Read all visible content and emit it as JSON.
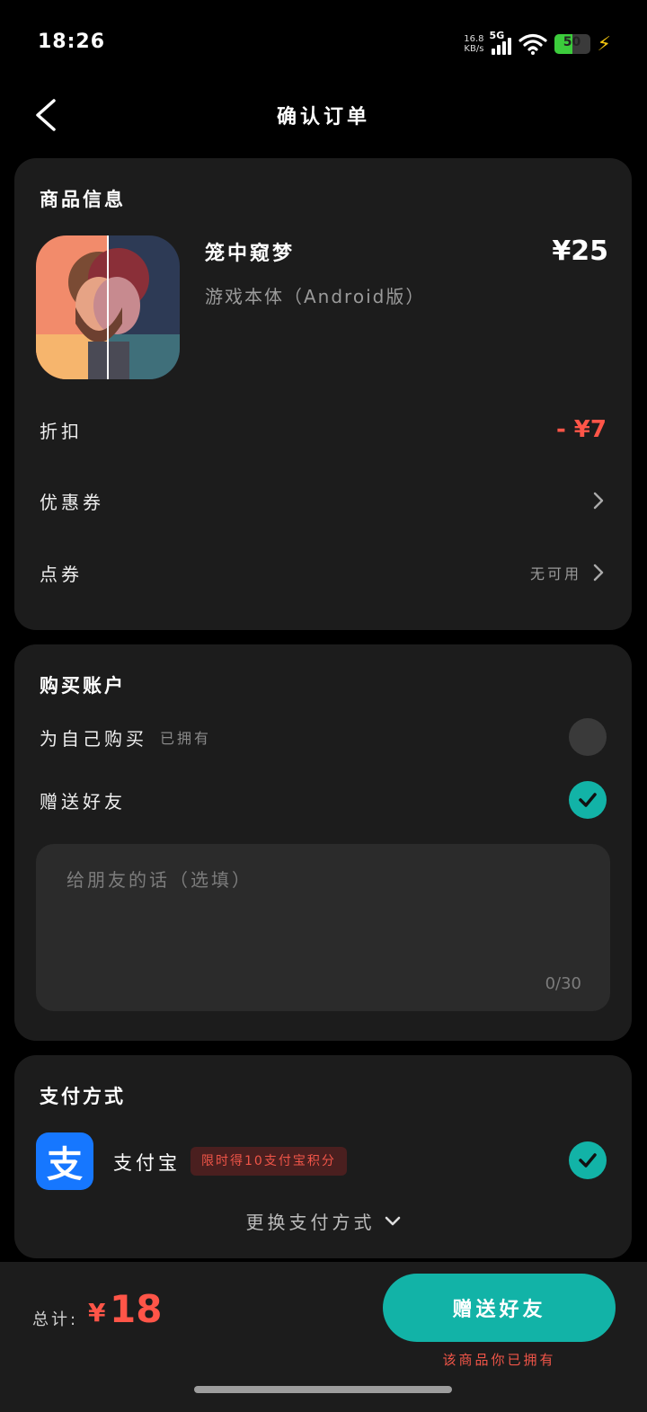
{
  "status_bar": {
    "time": "18:26",
    "net_speed_value": "16.8",
    "net_speed_unit": "KB/s",
    "network_type": "5G",
    "battery_level": "50"
  },
  "nav": {
    "title": "确认订单"
  },
  "product_section": {
    "title": "商品信息",
    "product_name": "笼中窥梦",
    "edition": "游戏本体（Android版）",
    "price": "¥25",
    "discount_label": "折扣",
    "discount_value": "- ¥7",
    "coupon_label": "优惠券",
    "points_label": "点券",
    "points_value": "无可用"
  },
  "account_section": {
    "title": "购买账户",
    "self_purchase_label": "为自己购买",
    "self_owned_tag": "已拥有",
    "gift_label": "赠送好友",
    "message_placeholder": "给朋友的话（选填）",
    "message_count": "0/30",
    "selected_option": "gift"
  },
  "payment_section": {
    "title": "支付方式",
    "method_icon_char": "支",
    "method_name": "支付宝",
    "promo": "限时得10支付宝积分",
    "change_label": "更换支付方式"
  },
  "bottom_bar": {
    "total_label": "总计:",
    "currency": "¥",
    "total_value": "18",
    "action_label": "赠送好友",
    "owned_notice": "该商品你已拥有"
  },
  "colors": {
    "accent": "#12b3a7",
    "price_red": "#ff5548",
    "card_bg": "#1c1c1c",
    "alipay_blue": "#1677ff"
  }
}
